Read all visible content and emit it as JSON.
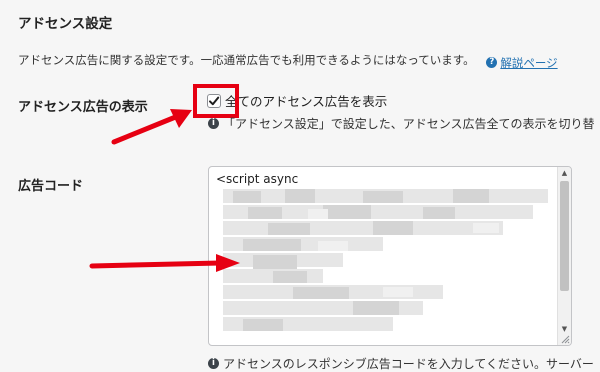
{
  "section": {
    "title": "アドセンス設定",
    "description": "アドセンス広告に関する設定です。一応通常広告でも利用できるようにはなっています。",
    "help_icon_char": "?",
    "help_link": "解説ページ"
  },
  "display_setting": {
    "label": "アドセンス広告の表示",
    "checkbox_label": "全てのアドセンス広告を表示",
    "checked": true,
    "note_icon_char": "i",
    "note": "「アドセンス設定」で設定した、アドセンス広告全ての表示を切り替"
  },
  "ad_code": {
    "label": "広告コード",
    "value_first_line": "<script async",
    "note_icon_char": "i",
    "note": "アドセンスのレスポンシブ広告コードを入力してください。サーバー"
  },
  "colors": {
    "annotation_red": "#e60012",
    "link_blue": "#2271b1",
    "background": "#f6f6f6"
  }
}
